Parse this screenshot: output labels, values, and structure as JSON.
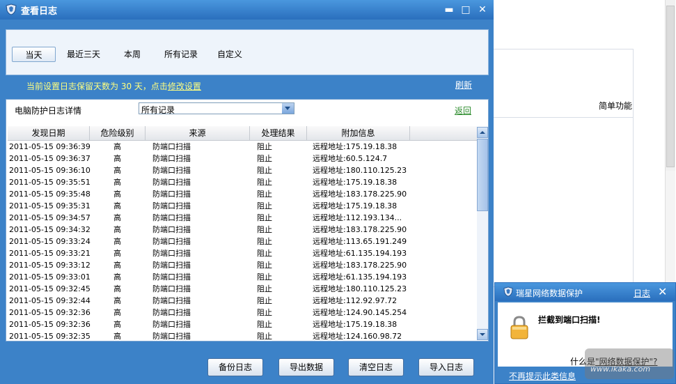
{
  "window": {
    "title": "查看日志",
    "min": "▬",
    "max": "□",
    "close": "✕"
  },
  "tabs": [
    {
      "label": "当天",
      "active": true
    },
    {
      "label": "最近三天",
      "active": false
    },
    {
      "label": "本周",
      "active": false
    },
    {
      "label": "所有记录",
      "active": false
    },
    {
      "label": "自定义",
      "active": false
    }
  ],
  "notice": {
    "text": "当前设置日志保留天数为 30 天，点击",
    "link": "修改设置"
  },
  "refresh": "刷新",
  "filter": {
    "label": "电脑防护日志详情",
    "selected": "所有记录",
    "back": "返回"
  },
  "table": {
    "headers": [
      "发现日期",
      "危险级别",
      "来源",
      "处理结果",
      "附加信息"
    ],
    "rows": [
      [
        "2011-05-15 09:36:39",
        "高",
        "防端口扫描",
        "阻止",
        "远程地址:175.19.18.38"
      ],
      [
        "2011-05-15 09:36:37",
        "高",
        "防端口扫描",
        "阻止",
        "远程地址:60.5.124.7"
      ],
      [
        "2011-05-15 09:36:10",
        "高",
        "防端口扫描",
        "阻止",
        "远程地址:180.110.125.23"
      ],
      [
        "2011-05-15 09:35:51",
        "高",
        "防端口扫描",
        "阻止",
        "远程地址:175.19.18.38"
      ],
      [
        "2011-05-15 09:35:48",
        "高",
        "防端口扫描",
        "阻止",
        "远程地址:183.178.225.90"
      ],
      [
        "2011-05-15 09:35:31",
        "高",
        "防端口扫描",
        "阻止",
        "远程地址:175.19.18.38"
      ],
      [
        "2011-05-15 09:34:57",
        "高",
        "防端口扫描",
        "阻止",
        "远程地址:112.193.134..."
      ],
      [
        "2011-05-15 09:34:32",
        "高",
        "防端口扫描",
        "阻止",
        "远程地址:183.178.225.90"
      ],
      [
        "2011-05-15 09:33:24",
        "高",
        "防端口扫描",
        "阻止",
        "远程地址:113.65.191.249"
      ],
      [
        "2011-05-15 09:33:21",
        "高",
        "防端口扫描",
        "阻止",
        "远程地址:61.135.194.193"
      ],
      [
        "2011-05-15 09:33:12",
        "高",
        "防端口扫描",
        "阻止",
        "远程地址:183.178.225.90"
      ],
      [
        "2011-05-15 09:33:01",
        "高",
        "防端口扫描",
        "阻止",
        "远程地址:61.135.194.193"
      ],
      [
        "2011-05-15 09:32:45",
        "高",
        "防端口扫描",
        "阻止",
        "远程地址:180.110.125.23"
      ],
      [
        "2011-05-15 09:32:44",
        "高",
        "防端口扫描",
        "阻止",
        "远程地址:112.92.97.72"
      ],
      [
        "2011-05-15 09:32:36",
        "高",
        "防端口扫描",
        "阻止",
        "远程地址:124.90.145.254"
      ],
      [
        "2011-05-15 09:32:36",
        "高",
        "防端口扫描",
        "阻止",
        "远程地址:175.19.18.38"
      ],
      [
        "2011-05-15 09:32:35",
        "高",
        "防端口扫描",
        "阻止",
        "远程地址:124.160.98.72"
      ]
    ]
  },
  "buttons": {
    "backup": "备份日志",
    "export": "导出数据",
    "clear": "清空日志",
    "import": "导入日志"
  },
  "background": {
    "label": "简单功能"
  },
  "popup": {
    "title": "瑞星网络数据保护",
    "log_link": "日志",
    "close": "✕",
    "message": "拦截到端口扫描!",
    "what_prefix": "什么是",
    "what_link": "\"网络数据保护\"?",
    "dont_show": "不再提示此类信息"
  },
  "watermark": "www.ikaka.com"
}
